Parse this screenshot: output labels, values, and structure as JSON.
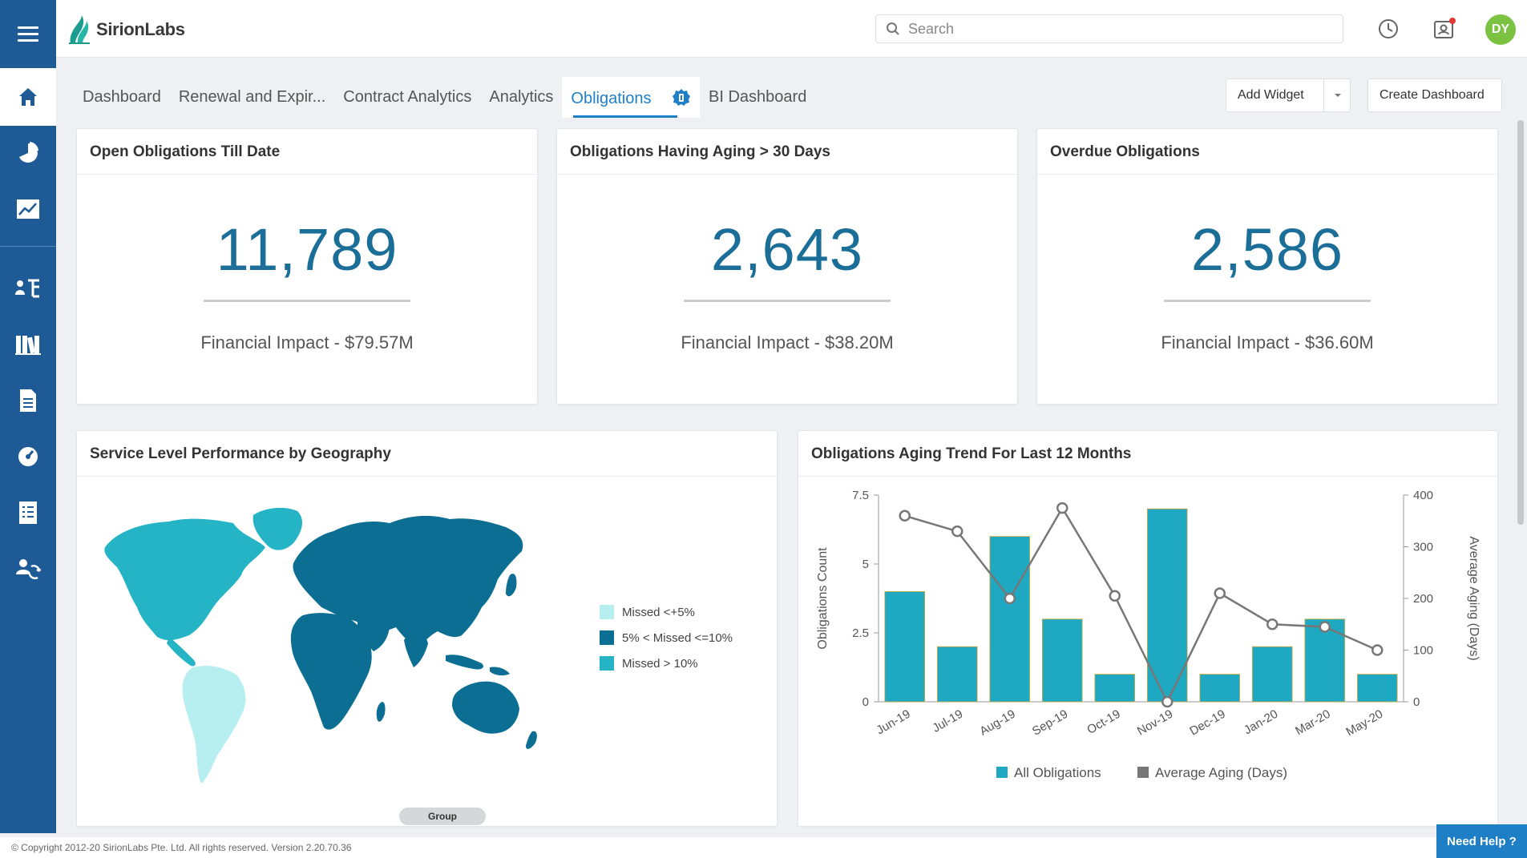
{
  "brand": {
    "name": "SirionLabs"
  },
  "header": {
    "search_placeholder": "Search",
    "user_initials": "DY",
    "icons": [
      "history-icon",
      "contact-card-icon"
    ]
  },
  "sidebar": {
    "items": [
      "home-icon",
      "pie-chart-icon",
      "trend-chart-icon",
      "org-hierarchy-icon",
      "library-icon",
      "document-icon",
      "gauge-icon",
      "list-icon",
      "people-sync-icon"
    ]
  },
  "tabs": [
    {
      "label": "Dashboard"
    },
    {
      "label": "Renewal and Expir..."
    },
    {
      "label": "Contract Analytics"
    },
    {
      "label": "Analytics"
    },
    {
      "label": "Obligations",
      "active": true
    },
    {
      "label": "BI Dashboard"
    }
  ],
  "toolbar": {
    "add_widget": "Add Widget",
    "create_dashboard": "Create Dashboard"
  },
  "kpis": [
    {
      "title": "Open Obligations Till Date",
      "value": "11,789",
      "sub": "Financial Impact - $79.57M"
    },
    {
      "title": "Obligations Having Aging > 30 Days",
      "value": "2,643",
      "sub": "Financial Impact - $38.20M"
    },
    {
      "title": "Overdue Obligations",
      "value": "2,586",
      "sub": "Financial Impact - $36.60M"
    }
  ],
  "map_widget": {
    "title": "Service Level Performance by Geography",
    "legend": [
      {
        "label": "Missed <+5%",
        "color": "#b7eef0"
      },
      {
        "label": "5% < Missed <=10%",
        "color": "#0c6e93"
      },
      {
        "label": "Missed > 10%",
        "color": "#25b3c6"
      }
    ],
    "group_label": "Group"
  },
  "chart_widget": {
    "title": "Obligations Aging Trend For Last 12 Months"
  },
  "chart_data": {
    "type": "bar",
    "categories": [
      "Jun-19",
      "Jul-19",
      "Aug-19",
      "Sep-19",
      "Oct-19",
      "Nov-19",
      "Dec-19",
      "Jan-20",
      "Mar-20",
      "May-20"
    ],
    "series": [
      {
        "name": "All Obligations",
        "type": "bar",
        "axis": "left",
        "color": "#1ea8c2",
        "values": [
          4,
          2,
          6,
          3,
          1,
          7,
          1,
          2,
          3,
          1
        ]
      },
      {
        "name": "Average Aging (Days)",
        "type": "line",
        "axis": "right",
        "color": "#777777",
        "values": [
          360,
          330,
          200,
          375,
          205,
          0,
          210,
          150,
          145,
          100
        ]
      }
    ],
    "ylabel": "Obligations Count",
    "y2label": "Average Aging (Days)",
    "ylim": [
      0,
      7.5
    ],
    "y2lim": [
      0,
      400
    ],
    "yticks": [
      "0",
      "2.5",
      "5",
      "7.5"
    ],
    "y2ticks": [
      "0",
      "100",
      "200",
      "300",
      "400"
    ],
    "legend_position": "bottom"
  },
  "footer": {
    "copyright": "© Copyright 2012-20 SirionLabs Pte. Ltd. All rights reserved. Version 2.20.70.36",
    "help": "Need Help ?"
  }
}
